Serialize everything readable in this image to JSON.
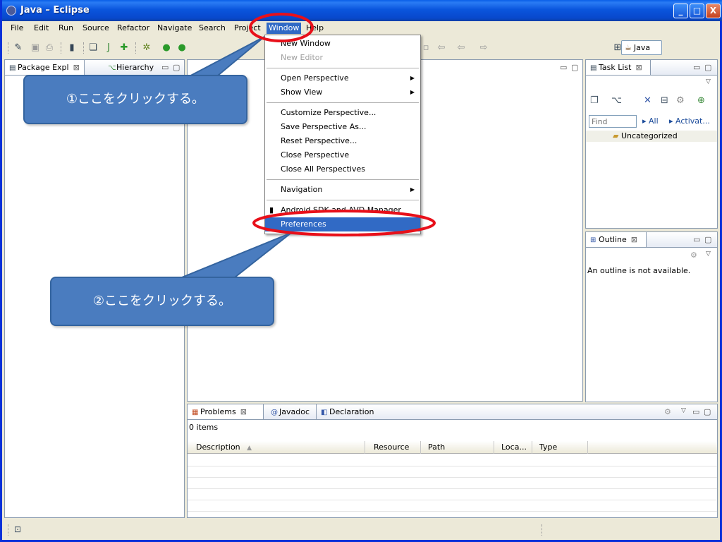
{
  "window": {
    "title": "Java – Eclipse",
    "minimize": "_",
    "maximize": "□",
    "close": "X"
  },
  "menubar": [
    "File",
    "Edit",
    "Run",
    "Source",
    "Refactor",
    "Navigate",
    "Search",
    "Project",
    "Window",
    "Help"
  ],
  "toolbar": {
    "perspective_label": "Java"
  },
  "left_panel": {
    "tabs": [
      {
        "label": "Package Expl",
        "icon": "package-explorer-icon"
      },
      {
        "label": "Hierarchy",
        "icon": "hierarchy-icon"
      }
    ]
  },
  "window_menu": {
    "items": [
      {
        "label": "New Window",
        "disabled": false
      },
      {
        "label": "New Editor",
        "disabled": true
      },
      {
        "label": "Open Perspective",
        "submenu": true
      },
      {
        "label": "Show View",
        "submenu": true
      },
      {
        "label": "Customize Perspective...",
        "submenu": false
      },
      {
        "label": "Save Perspective As...",
        "submenu": false
      },
      {
        "label": "Reset Perspective...",
        "submenu": false
      },
      {
        "label": "Close Perspective",
        "submenu": false
      },
      {
        "label": "Close All Perspectives",
        "submenu": false
      },
      {
        "label": "Navigation",
        "submenu": true
      },
      {
        "label": "Android SDK and AVD Manager",
        "submenu": false
      },
      {
        "label": "Preferences",
        "selected": true
      }
    ]
  },
  "task_list": {
    "tab_label": "Task List",
    "find_placeholder": "Find",
    "filter_all": "All",
    "filter_activate": "Activat...",
    "category": "Uncategorized"
  },
  "outline": {
    "tab_label": "Outline",
    "message": "An outline is not available."
  },
  "bottom_panel": {
    "tabs": [
      {
        "label": "Problems"
      },
      {
        "label": "Javadoc"
      },
      {
        "label": "Declaration"
      }
    ],
    "summary": "0 items",
    "columns": [
      "Description",
      "Resource",
      "Path",
      "Loca...",
      "Type"
    ]
  },
  "annotations": {
    "callout1": "①ここをクリックする。",
    "callout2": "②ここをクリックする。"
  },
  "colors": {
    "accent": "#316ac5",
    "callout": "#4a7cbf",
    "highlight_ring": "#e8101a",
    "title_bar": "#0a55dd"
  }
}
